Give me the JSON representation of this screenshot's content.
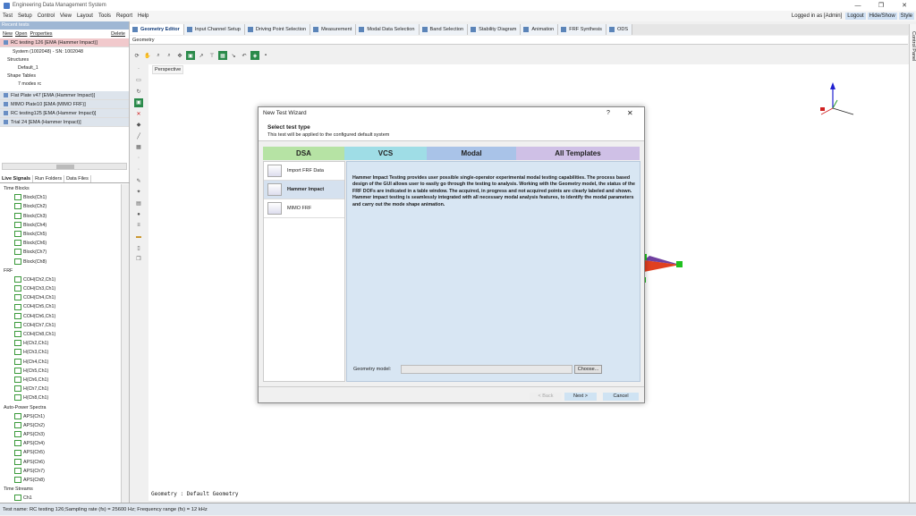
{
  "window": {
    "title": "Engineering Data Management System"
  },
  "menu": {
    "items": [
      "Test",
      "Setup",
      "Control",
      "View",
      "Layout",
      "Tools",
      "Report",
      "Help"
    ],
    "login": "Logged in as [Admin]",
    "logout": "Logout",
    "hideshow": "Hide/Show",
    "style": "Style"
  },
  "left": {
    "header": "Recent tests",
    "actions": {
      "new": "New",
      "open": "Open",
      "properties": "Properties",
      "delete": "Delete"
    },
    "current": "RC testing 126  [EMA (Hammer Impact)]",
    "tree": [
      "System (1002048) - SN: 1002048",
      "Structures",
      "Default_1",
      "Shape Tables",
      "7 modes rc"
    ],
    "recent": [
      "Flat Plate v47  [EMA (Hammer Impact)]",
      "MIMO Plate10  [EMA (MIMO FRF)]",
      "RC testing125  [EMA (Hammer Impact)]",
      "Trial 24  [EMA (Hammer Impact)]"
    ],
    "tabs": [
      "Live Signals",
      "Run Folders",
      "Data Files"
    ],
    "groups": {
      "time_blocks": "Time Blocks",
      "frf": "FRF",
      "aps": "Auto-Power Spectra",
      "streams": "Time Streams"
    },
    "time_block_items": [
      "Block(Ch1)",
      "Block(Ch2)",
      "Block(Ch3)",
      "Block(Ch4)",
      "Block(Ch5)",
      "Block(Ch6)",
      "Block(Ch7)",
      "Block(Ch8)"
    ],
    "frf_items": [
      "COH(Ch2,Ch1)",
      "COH(Ch3,Ch1)",
      "COH(Ch4,Ch1)",
      "COH(Ch5,Ch1)",
      "COH(Ch6,Ch1)",
      "COH(Ch7,Ch1)",
      "COH(Ch8,Ch1)",
      "H(Ch2,Ch1)",
      "H(Ch3,Ch1)",
      "H(Ch4,Ch1)",
      "H(Ch5,Ch1)",
      "H(Ch6,Ch1)",
      "H(Ch7,Ch1)",
      "H(Ch8,Ch1)"
    ],
    "aps_items": [
      "APS(Ch1)",
      "APS(Ch2)",
      "APS(Ch3)",
      "APS(Ch4)",
      "APS(Ch5)",
      "APS(Ch6)",
      "APS(Ch7)",
      "APS(Ch8)"
    ],
    "stream_items": [
      "Ch1"
    ]
  },
  "tabs": [
    "Geometry Editor",
    "Input Channel Setup",
    "Driving Point Selection",
    "Measurement",
    "Modal Data Selection",
    "Band Selection",
    "Stability Diagram",
    "Animation",
    "FRF Synthesis",
    "ODS"
  ],
  "geometry": {
    "tab_label": "Geometry",
    "view": "Perspective",
    "caption": "Geometry : Default Geometry"
  },
  "control_panel": "Control Panel",
  "status": "Test name: RC testing 126;Sampling rate (fs) = 25600 Hz; Frequency range (fs) =  12 kHz",
  "dialog": {
    "title": "New Test Wizard",
    "help": "?",
    "close": "✕",
    "heading": "Select test type",
    "subheading": "This test will be applied to the configured default system",
    "categories": [
      "DSA",
      "VCS",
      "Modal",
      "All  Templates"
    ],
    "types": [
      "Import FRF Data",
      "Hammer Impact",
      "MIMO FRF"
    ],
    "description": "Hammer Impact Testing provides user possible single-operator experimental modal testing capabilities. The process based design of the GUI allows user to easily go through the testing to analysis. Working with the Geometry model, the status of the FRF DOFs are indicated in a table window. The acquired, in progress and not acquired points are clearly labeled and shown. Hammer impact testing is seamlessly integrated with all necessary modal analysis features, to identify the modal parameters and carry out the mode shape animation.",
    "geometry_label": "Geometry model:",
    "choose": "Choose...",
    "back": "< Back",
    "next": "Next >",
    "cancel": "Cancel"
  }
}
